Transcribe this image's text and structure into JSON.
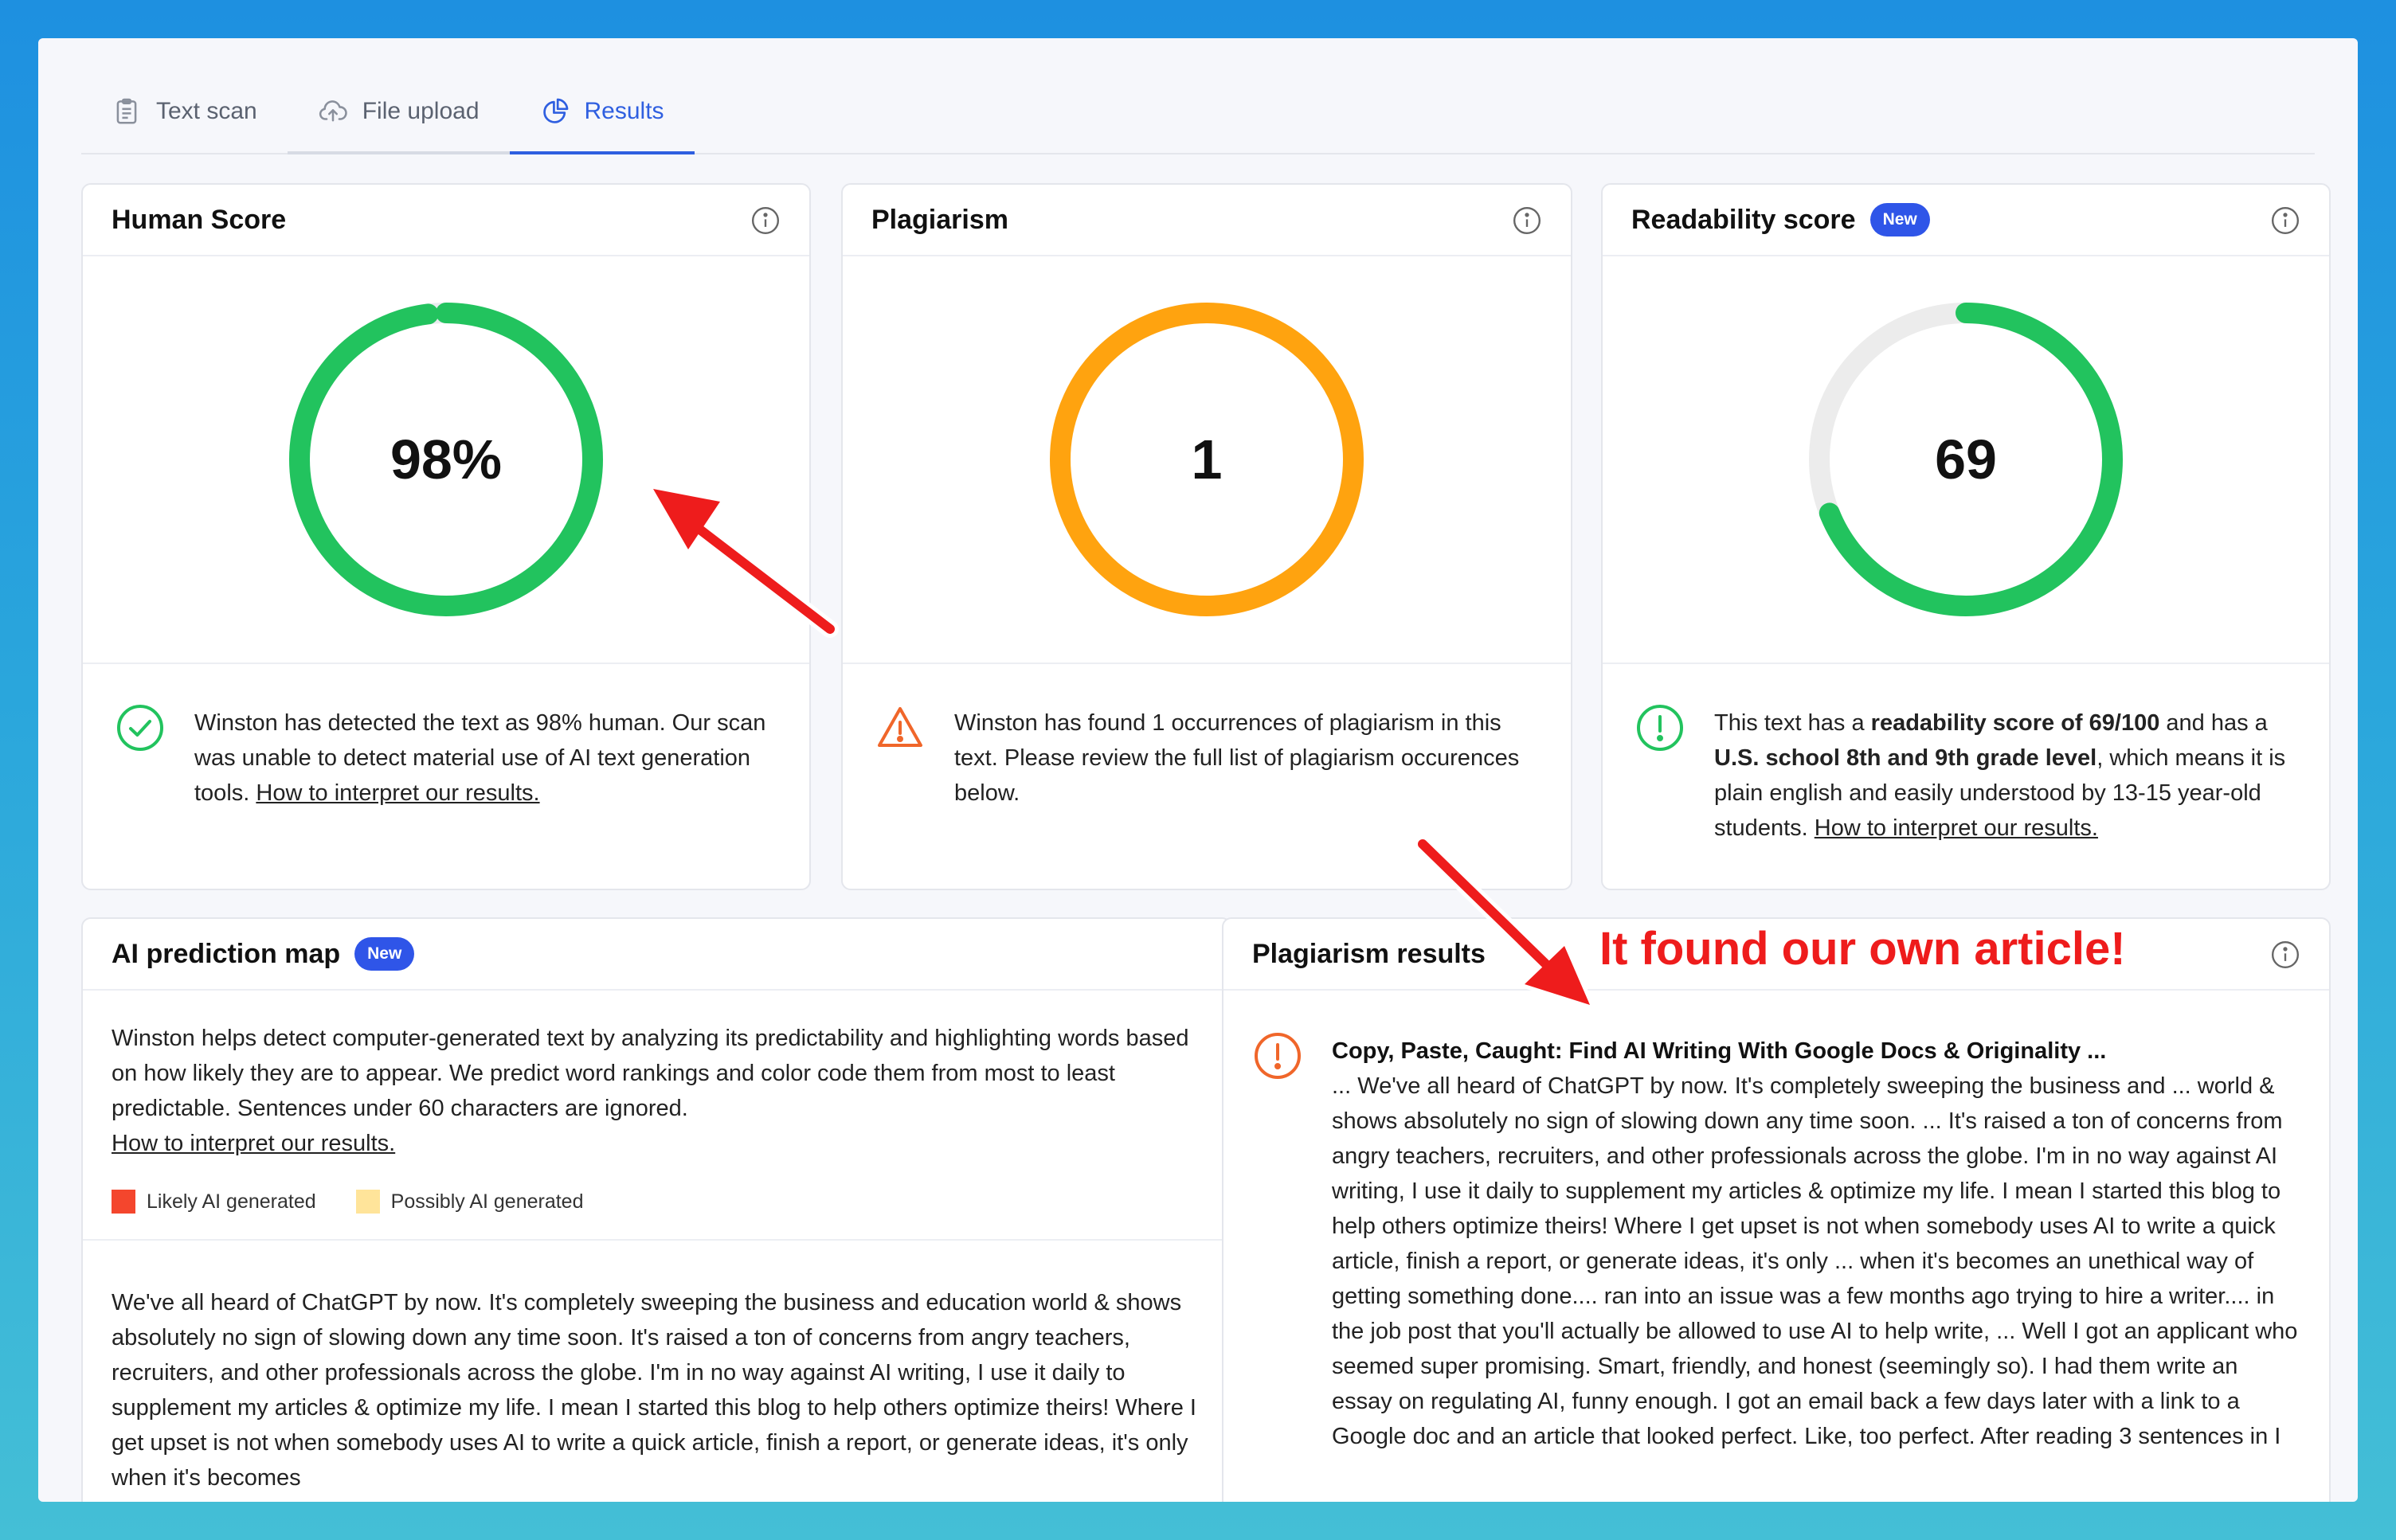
{
  "tabs": [
    {
      "label": "Text scan",
      "icon": "clipboard-icon"
    },
    {
      "label": "File upload",
      "icon": "cloud-upload-icon"
    },
    {
      "label": "Results",
      "icon": "pie-chart-icon",
      "active": true
    }
  ],
  "human_score": {
    "title": "Human Score",
    "value_label": "98%",
    "value": 0.98,
    "color": "#22c35e",
    "description": "Winston has detected the text as 98% human. Our scan was unable to detect material use of AI text generation tools. ",
    "link": "How to interpret our results."
  },
  "plagiarism": {
    "title": "Plagiarism",
    "value_label": "1",
    "color": "#ffa30f",
    "description": "Winston has found 1 occurrences of plagiarism in this text. Please review the full list of plagiarism occurences below."
  },
  "readability": {
    "title": "Readability score",
    "badge": "New",
    "value_label": "69",
    "value": 0.69,
    "color": "#22c35e",
    "track_color": "#ececec",
    "desc_1": "This text has a ",
    "desc_bold_1": "readability score of 69/100",
    "desc_2": " and has a ",
    "desc_bold_2": "U.S. school 8th and 9th grade level",
    "desc_3": ", which means it is plain english and easily understood by 13-15 year-old students. ",
    "link": "How to interpret our results."
  },
  "ai_map": {
    "title": "AI prediction map",
    "badge": "New",
    "intro": "Winston helps detect computer-generated text by analyzing its predictability and highlighting words based on how likely they are to appear. We predict word rankings and color code them from most to least predictable. Sentences under 60 characters are ignored.",
    "link": "How to interpret our results.",
    "legend": [
      {
        "label": "Likely AI generated",
        "color": "#f4462d"
      },
      {
        "label": "Possibly AI generated",
        "color": "#ffe49a"
      }
    ],
    "text": "We've all heard of ChatGPT by now. It's completely sweeping the business and education world & shows absolutely no sign of slowing down any time soon. It's raised a ton of concerns from angry teachers, recruiters, and other professionals across the globe. I'm in no way against AI writing, I use it daily to supplement my articles & optimize my life. I mean I started this blog to help others optimize theirs! Where I get upset is not when somebody uses AI to write a quick article, finish a report, or generate ideas, it's only when it's becomes"
  },
  "plagiarism_results": {
    "title": "Plagiarism results",
    "source_title": "Copy, Paste, Caught: Find AI Writing With Google Docs & Originality ...",
    "excerpt": "... We've all heard of ChatGPT by now. It's completely sweeping the business and ... world & shows absolutely no sign of slowing down any time soon. ... It's raised a ton of concerns from angry teachers, recruiters, and other professionals across the globe. I'm in no way against AI writing, I use it daily to supplement my articles & optimize my life. I mean I started this blog to help others optimize theirs! Where I get upset is not when somebody uses AI to write a quick article, finish a report, or generate ideas, it's only ... when it's becomes an unethical way of getting something done.... ran into an issue was a few months ago trying to hire a writer.... in the job post that you'll actually be allowed to use AI to help write, ... Well I got an applicant who seemed super promising. Smart, friendly, and honest (seemingly so). I had them write an essay on regulating AI, funny enough. I got an email back a few days later with a link to a Google doc and an article that looked perfect. Like, too perfect. After reading 3 sentences in I"
  },
  "annotation": {
    "callout": "It found our own article!",
    "arrow_color": "#ee1c1c"
  }
}
